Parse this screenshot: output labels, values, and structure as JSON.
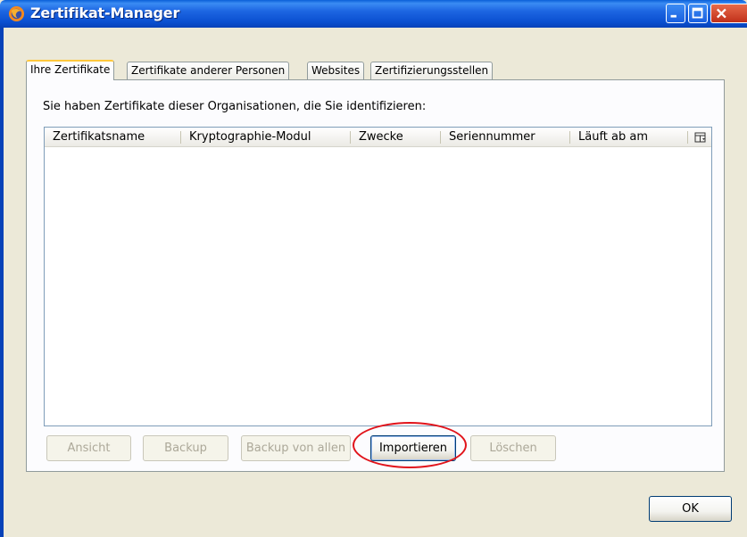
{
  "window": {
    "title": "Zertifikat-Manager"
  },
  "tabs": [
    {
      "label": "Ihre Zertifikate",
      "active": true
    },
    {
      "label": "Zertifikate anderer Personen",
      "active": false
    },
    {
      "label": "Websites",
      "active": false
    },
    {
      "label": "Zertifizierungsstellen",
      "active": false
    }
  ],
  "panel": {
    "intro": "Sie haben Zertifikate dieser Organisationen, die Sie identifizieren:"
  },
  "table": {
    "columns": [
      "Zertifikatsname",
      "Kryptographie-Modul",
      "Zwecke",
      "Seriennummer",
      "Läuft ab am"
    ],
    "rows": []
  },
  "buttons": {
    "view": "Ansicht",
    "backup": "Backup",
    "backup_all": "Backup von allen",
    "import": "Importieren",
    "delete": "Löschen",
    "ok": "OK"
  },
  "colors": {
    "titlebar": "#0a4fd0",
    "highlight": "#e1141b",
    "dialog_bg": "#ece9d8"
  }
}
